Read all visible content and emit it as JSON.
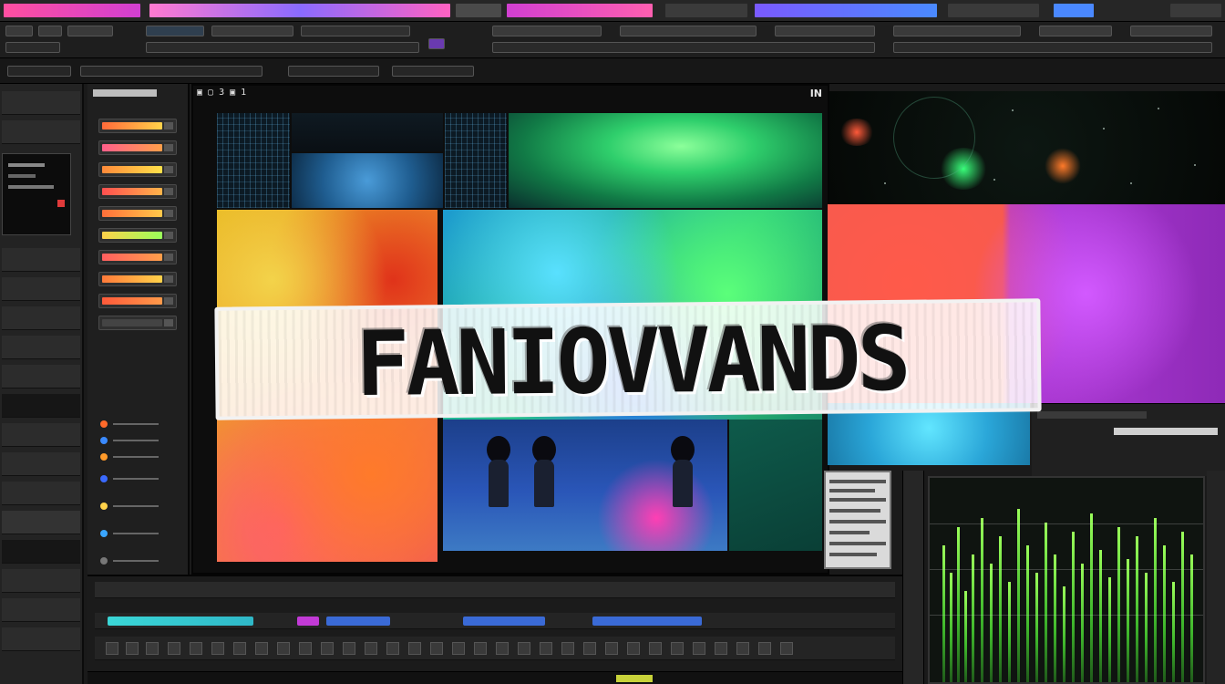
{
  "monitor": {
    "tab_label": "▣ ▢ 3 ▣ 1",
    "tab_right": "IN"
  },
  "title_overlay": {
    "text": "FANIOVVANDS"
  },
  "colors": {
    "warm_tile": "#f28b2f",
    "green_tile": "#2fcf6c",
    "teal_tile": "#27c67c",
    "purple_tile": "#b13cd9",
    "red_tile": "#f55a4f",
    "cyan_tile": "#2aa6d8",
    "timeline_clip_cyan": "#3ad6d6",
    "timeline_clip_magenta": "#c23ad6",
    "timeline_clip_blue": "#3a6ad6",
    "scope_green": "#9aff5a"
  },
  "icons": {
    "play": "play-icon",
    "record": "record-icon",
    "settings": "gear-icon",
    "audio": "speaker-icon"
  }
}
